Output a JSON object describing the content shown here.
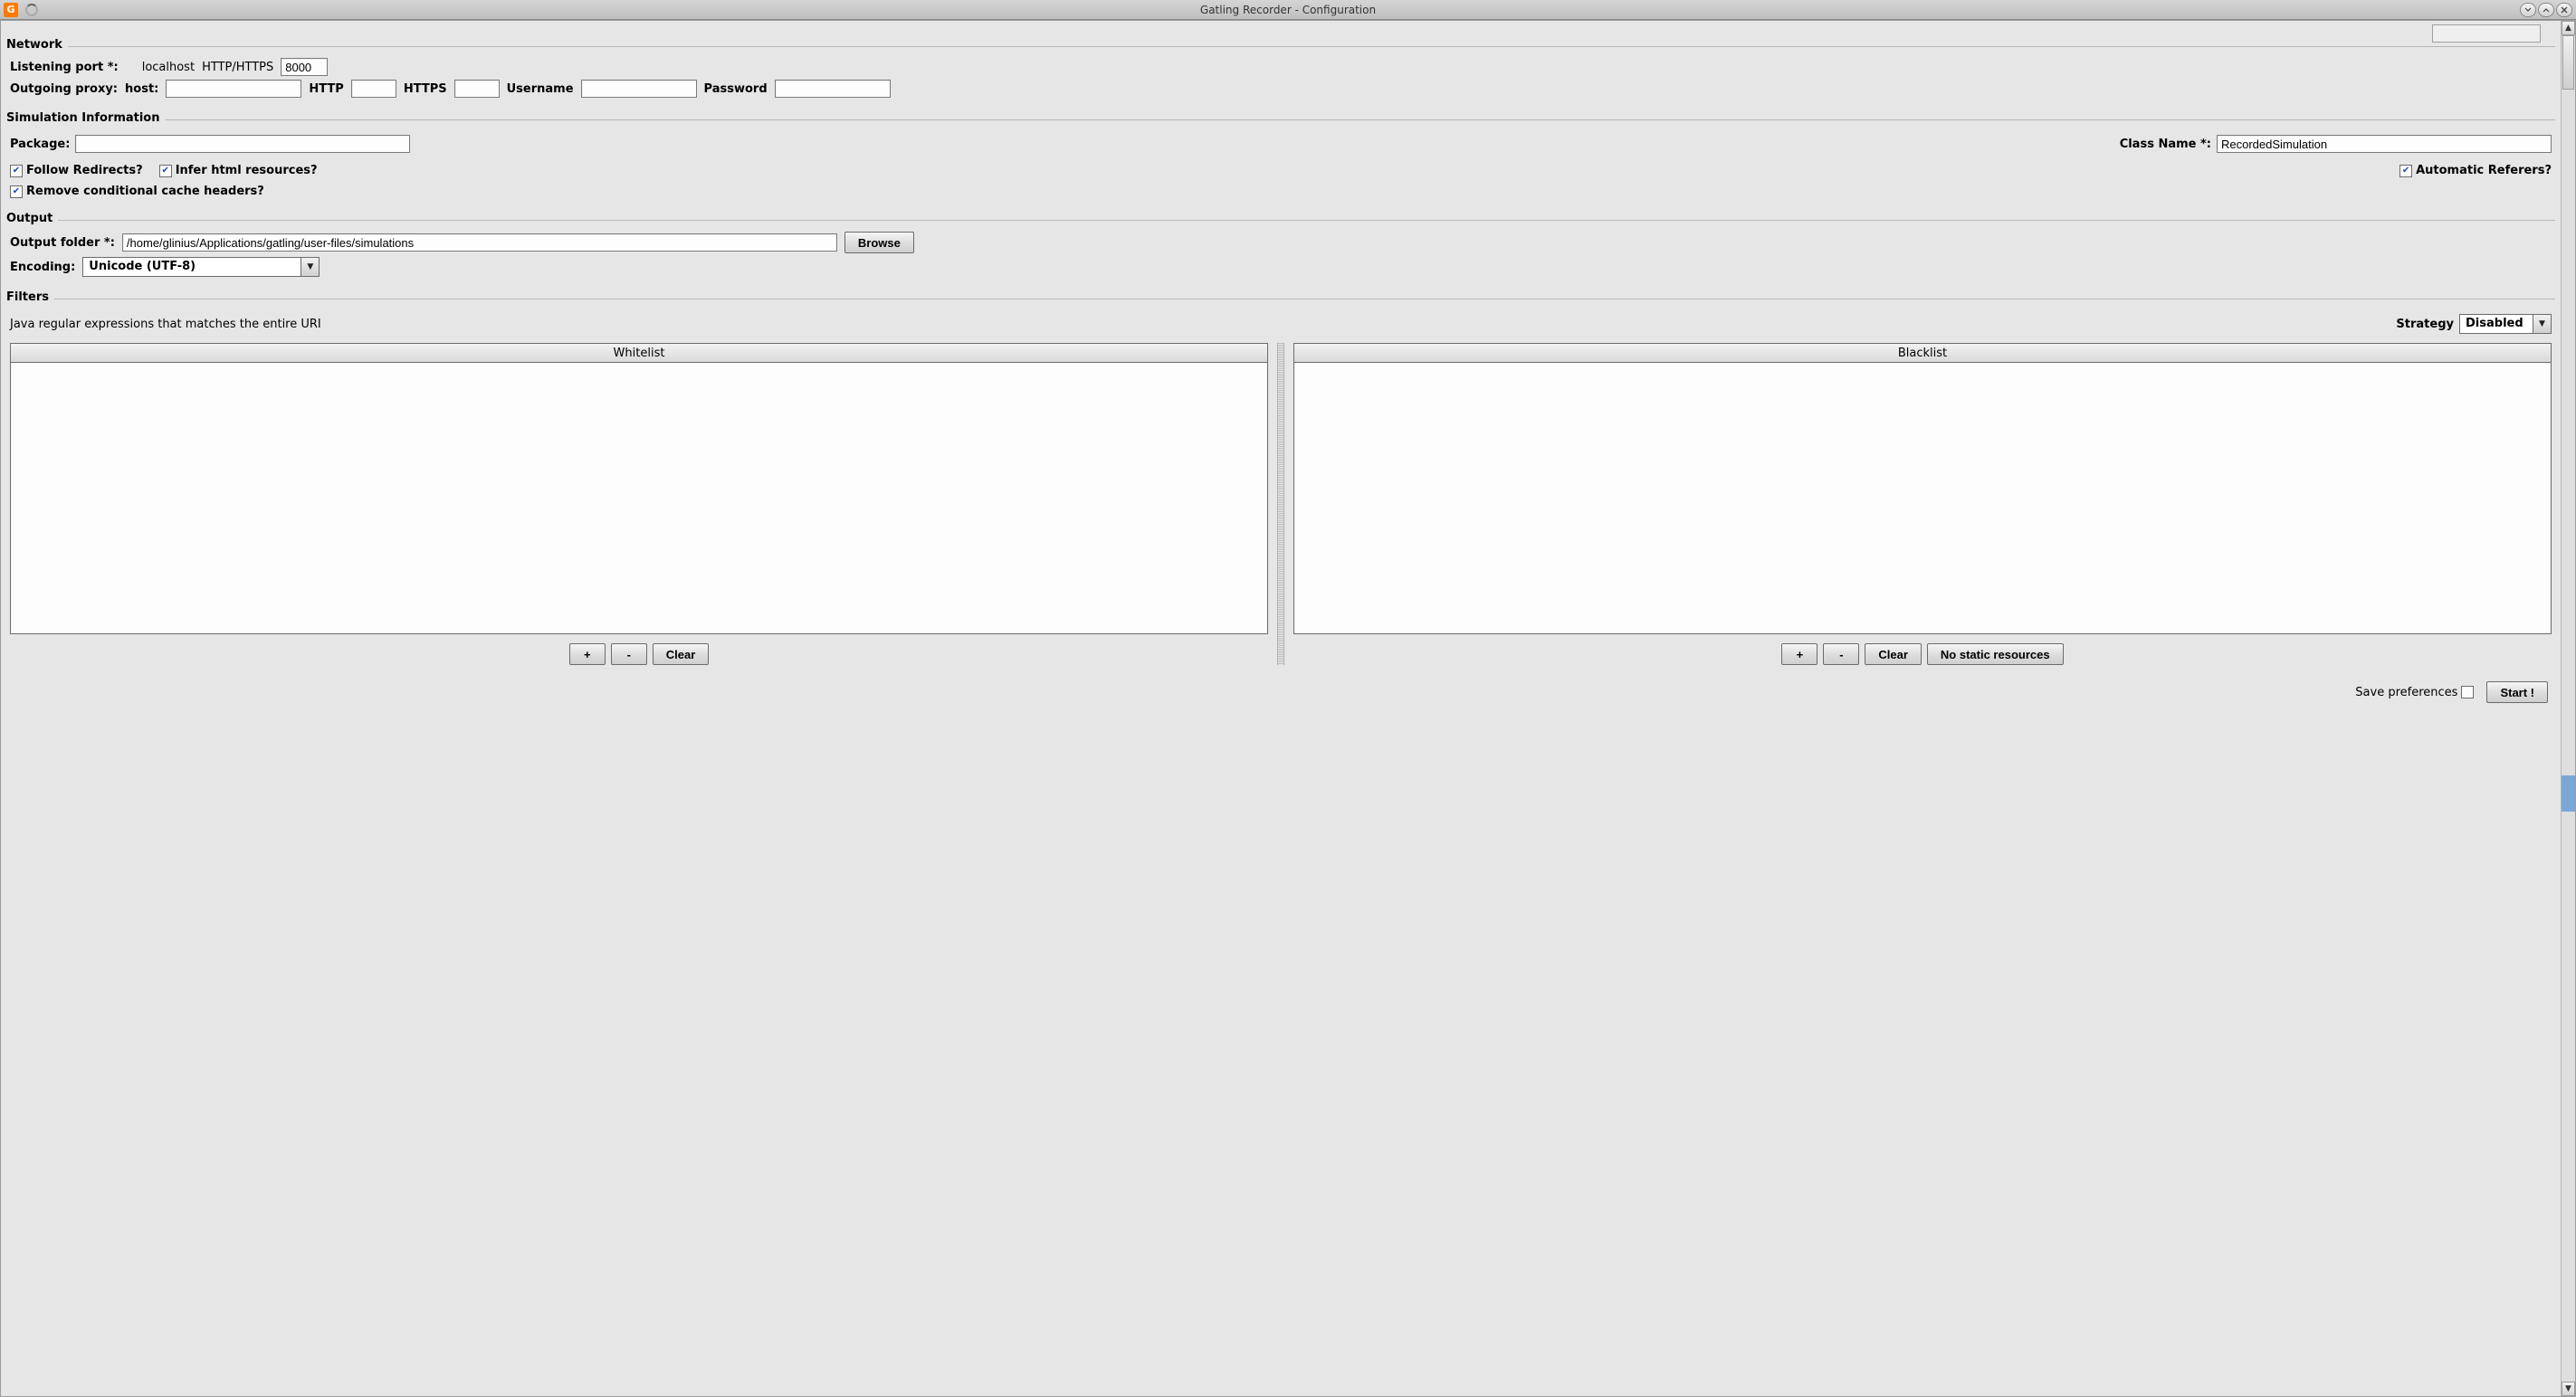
{
  "window": {
    "title": "Gatling Recorder - Configuration"
  },
  "groups": {
    "network": {
      "legend": "Network",
      "listening_port_label": "Listening port *:",
      "localhost_label": "localhost",
      "http_https_label": "HTTP/HTTPS",
      "port_value": "8000",
      "outgoing_proxy_label": "Outgoing proxy:",
      "host_label": "host:",
      "host_value": "",
      "http_label": "HTTP",
      "http_value": "",
      "https_label": "HTTPS",
      "https_value": "",
      "username_label": "Username",
      "username_value": "",
      "password_label": "Password",
      "password_value": ""
    },
    "simulation": {
      "legend": "Simulation Information",
      "package_label": "Package:",
      "package_value": "",
      "class_name_label": "Class Name *:",
      "class_name_value": "RecordedSimulation",
      "follow_redirects_label": "Follow Redirects?",
      "follow_redirects_checked": true,
      "infer_html_label": "Infer html resources?",
      "infer_html_checked": true,
      "auto_referers_label": "Automatic Referers?",
      "auto_referers_checked": true,
      "remove_cache_label": "Remove conditional cache headers?",
      "remove_cache_checked": true
    },
    "output": {
      "legend": "Output",
      "output_folder_label": "Output folder *:",
      "output_folder_value": "/home/glinius/Applications/gatling/user-files/simulations",
      "browse_label": "Browse",
      "encoding_label": "Encoding:",
      "encoding_value": "Unicode (UTF-8)"
    },
    "filters": {
      "legend": "Filters",
      "description": "Java regular expressions that matches the entire URI",
      "strategy_label": "Strategy",
      "strategy_value": "Disabled",
      "whitelist_header": "Whitelist",
      "blacklist_header": "Blacklist",
      "add_label": "+",
      "remove_label": "-",
      "clear_label": "Clear",
      "no_static_label": "No static resources"
    }
  },
  "bottom": {
    "save_prefs_label": "Save preferences",
    "save_prefs_checked": false,
    "start_label": "Start !"
  }
}
